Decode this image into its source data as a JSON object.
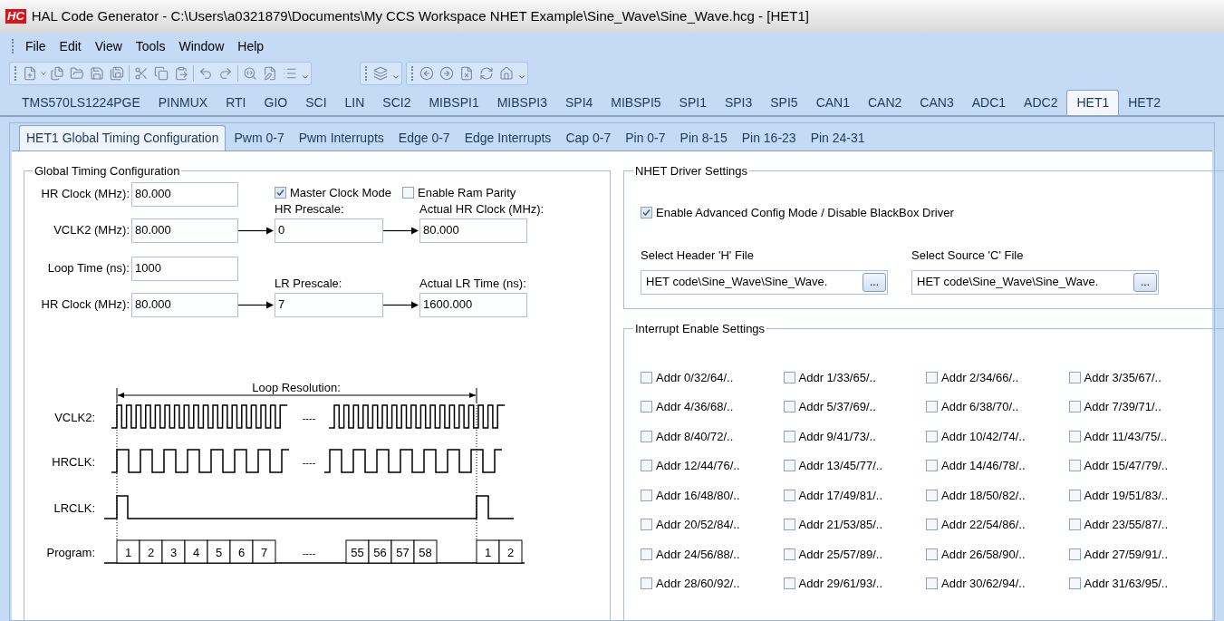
{
  "window": {
    "app_icon": "HC",
    "title": "HAL Code Generator - C:\\Users\\a0321879\\Documents\\My CCS Workspace NHET Example\\Sine_Wave\\Sine_Wave.hcg - [HET1]"
  },
  "menu": [
    "File",
    "Edit",
    "View",
    "Tools",
    "Window",
    "Help"
  ],
  "module_tabs": [
    {
      "label": "TMS570LS1224PGE",
      "selected": false
    },
    {
      "label": "PINMUX",
      "selected": false
    },
    {
      "label": "RTI",
      "selected": false
    },
    {
      "label": "GIO",
      "selected": false
    },
    {
      "label": "SCI",
      "selected": false
    },
    {
      "label": "LIN",
      "selected": false
    },
    {
      "label": "SCI2",
      "selected": false
    },
    {
      "label": "MIBSPI1",
      "selected": false
    },
    {
      "label": "MIBSPI3",
      "selected": false
    },
    {
      "label": "SPI4",
      "selected": false
    },
    {
      "label": "MIBSPI5",
      "selected": false
    },
    {
      "label": "SPI1",
      "selected": false
    },
    {
      "label": "SPI3",
      "selected": false
    },
    {
      "label": "SPI5",
      "selected": false
    },
    {
      "label": "CAN1",
      "selected": false
    },
    {
      "label": "CAN2",
      "selected": false
    },
    {
      "label": "CAN3",
      "selected": false
    },
    {
      "label": "ADC1",
      "selected": false
    },
    {
      "label": "ADC2",
      "selected": false
    },
    {
      "label": "HET1",
      "selected": true
    },
    {
      "label": "HET2",
      "selected": false
    }
  ],
  "sub_tabs": [
    {
      "label": "HET1 Global Timing Configuration",
      "selected": true
    },
    {
      "label": "Pwm 0-7",
      "selected": false
    },
    {
      "label": "Pwm Interrupts",
      "selected": false
    },
    {
      "label": "Edge 0-7",
      "selected": false
    },
    {
      "label": "Edge Interrupts",
      "selected": false
    },
    {
      "label": "Cap 0-7",
      "selected": false
    },
    {
      "label": "Pin 0-7",
      "selected": false
    },
    {
      "label": "Pin 8-15",
      "selected": false
    },
    {
      "label": "Pin 16-23",
      "selected": false
    },
    {
      "label": "Pin 24-31",
      "selected": false
    }
  ],
  "global_timing": {
    "title": "Global Timing Configuration",
    "hr_clock": {
      "label": "HR Clock (MHz):",
      "value": "80.000"
    },
    "options": [
      {
        "label": "Master Clock Mode",
        "checked": true
      },
      {
        "label": "Enable Ram Parity",
        "checked": false
      }
    ],
    "hr_chain": {
      "source": {
        "label": "VCLK2 (MHz):",
        "value": "80.000"
      },
      "prescale": {
        "label": "HR Prescale:",
        "value": "0"
      },
      "result": {
        "label": "Actual HR Clock (MHz):",
        "value": "80.000"
      }
    },
    "loop_time": {
      "label": "Loop Time (ns):",
      "value": "1000"
    },
    "lr_chain": {
      "source": {
        "label": "HR Clock (MHz):",
        "value": "80.000"
      },
      "prescale": {
        "label": "LR Prescale:",
        "value": "7"
      },
      "result": {
        "label": "Actual LR Time (ns):",
        "value": "1600.000"
      }
    },
    "diagram": {
      "title": "Loop Resolution:",
      "signals": [
        {
          "label": "VCLK2:",
          "kind": "fast",
          "gap": "----"
        },
        {
          "label": "HRCLK:",
          "kind": "medium",
          "gap": "----"
        },
        {
          "label": "LRCLK:",
          "kind": "pulse"
        }
      ],
      "program": {
        "label": "Program:",
        "gap": "----",
        "groups": [
          [
            "1",
            "2",
            "3",
            "4",
            "5",
            "6",
            "7"
          ],
          [
            "55",
            "56",
            "57",
            "58"
          ],
          [
            "1",
            "2"
          ]
        ]
      }
    }
  },
  "driver_settings": {
    "title": "NHET Driver Settings",
    "advanced": {
      "label": "Enable Advanced Config Mode / Disable BlackBox Driver",
      "checked": true
    },
    "files": [
      {
        "label": "Select Header 'H' File",
        "value": "HET code\\Sine_Wave\\Sine_Wave.",
        "button": "..."
      },
      {
        "label": "Select Source 'C' File",
        "value": "HET code\\Sine_Wave\\Sine_Wave.",
        "button": "..."
      }
    ]
  },
  "interrupts": {
    "title": "Interrupt Enable Settings",
    "items": [
      {
        "label": "Addr 0/32/64/..",
        "checked": false
      },
      {
        "label": "Addr 1/33/65/..",
        "checked": false
      },
      {
        "label": "Addr 2/34/66/..",
        "checked": false
      },
      {
        "label": "Addr 3/35/67/..",
        "checked": false
      },
      {
        "label": "Addr 4/36/68/..",
        "checked": false
      },
      {
        "label": "Addr 5/37/69/..",
        "checked": false
      },
      {
        "label": "Addr 6/38/70/..",
        "checked": false
      },
      {
        "label": "Addr 7/39/71/..",
        "checked": false
      },
      {
        "label": "Addr 8/40/72/..",
        "checked": false
      },
      {
        "label": "Addr 9/41/73/..",
        "checked": false
      },
      {
        "label": "Addr 10/42/74/..",
        "checked": false
      },
      {
        "label": "Addr 11/43/75/..",
        "checked": false
      },
      {
        "label": "Addr 12/44/76/..",
        "checked": false
      },
      {
        "label": "Addr 13/45/77/..",
        "checked": false
      },
      {
        "label": "Addr 14/46/78/..",
        "checked": false
      },
      {
        "label": "Addr 15/47/79/..",
        "checked": false
      },
      {
        "label": "Addr 16/48/80/..",
        "checked": false
      },
      {
        "label": "Addr 17/49/81/..",
        "checked": false
      },
      {
        "label": "Addr 18/50/82/..",
        "checked": false
      },
      {
        "label": "Addr 19/51/83/..",
        "checked": false
      },
      {
        "label": "Addr 20/52/84/..",
        "checked": false
      },
      {
        "label": "Addr 21/53/85/..",
        "checked": false
      },
      {
        "label": "Addr 22/54/86/..",
        "checked": false
      },
      {
        "label": "Addr 23/55/87/..",
        "checked": false
      },
      {
        "label": "Addr 24/56/88/..",
        "checked": false
      },
      {
        "label": "Addr 25/57/89/..",
        "checked": false
      },
      {
        "label": "Addr 26/58/90/..",
        "checked": false
      },
      {
        "label": "Addr 27/59/91/..",
        "checked": false
      },
      {
        "label": "Addr 28/60/92/..",
        "checked": false
      },
      {
        "label": "Addr 29/61/93/..",
        "checked": false
      },
      {
        "label": "Addr 30/62/94/..",
        "checked": false
      },
      {
        "label": "Addr 31/63/95/..",
        "checked": false
      }
    ]
  }
}
